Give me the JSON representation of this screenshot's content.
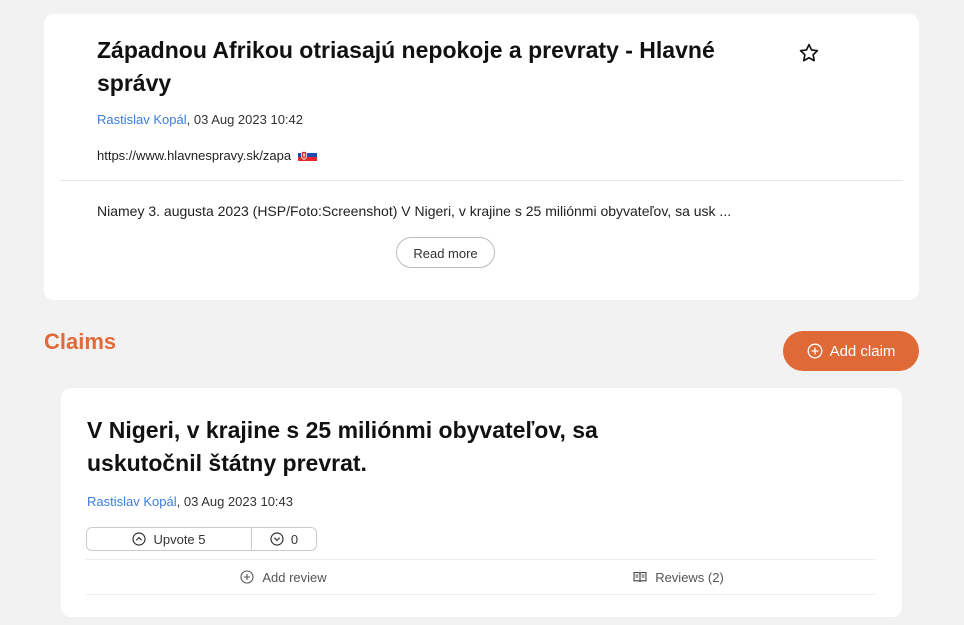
{
  "article": {
    "title": "Západnou Afrikou otriasajú nepokoje a prevraty - Hlavné správy",
    "author": "Rastislav Kopál",
    "date": ", 03 Aug 2023 10:42",
    "url": "https://www.hlavnespravy.sk/zapa",
    "excerpt": "Niamey 3. augusta 2023 (HSP/Foto:Screenshot) V Nigeri, v krajine s 25 miliónmi obyvateľov, sa usk ...",
    "read_more_label": "Read more",
    "icons": {
      "favorite": "star-outline-icon",
      "flag": "slovakia-flag-icon"
    }
  },
  "claims": {
    "heading": "Claims",
    "add_label": "Add claim",
    "items": [
      {
        "title": "V Nigeri, v krajine s 25 miliónmi obyvateľov, sa uskutočnil štátny prevrat.",
        "author": "Rastislav Kopál",
        "date": ", 03 Aug 2023 10:43",
        "upvote_label": "Upvote 5",
        "downvote_count": "0",
        "add_review_label": "Add review",
        "reviews_label": "Reviews (2)"
      }
    ]
  },
  "colors": {
    "accent": "#df6a38",
    "author_link": "#3b7ddd",
    "background": "#f2f2f2"
  }
}
